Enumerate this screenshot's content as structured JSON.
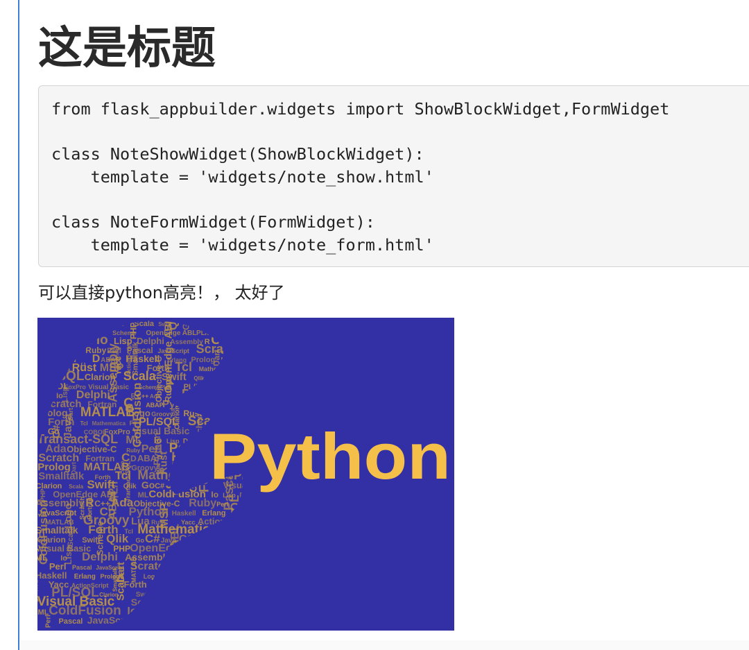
{
  "article": {
    "title": "这是标题",
    "code_lines": [
      "from flask_appbuilder.widgets import ShowBlockWidget,FormWidget",
      "",
      "class NoteShowWidget(ShowBlockWidget):",
      "    template = 'widgets/note_show.html'",
      "",
      "class NoteFormWidget(FormWidget):",
      "    template = 'widgets/note_form.html'"
    ],
    "caption": "可以直接python高亮！， 太好了"
  },
  "image": {
    "logo_text": "Python",
    "background_color": "#3230a4",
    "logo_color": "#f4c04a",
    "word_cloud_color": "#b8924a",
    "word_cloud_words": [
      "F#",
      "PL/SQL",
      "Clarion",
      "Scala",
      "Swift",
      "Qlik",
      "Go",
      "C#",
      "Java",
      "COBOL",
      "FoxPro",
      "Visual Basic",
      "Scheme",
      "PHP",
      "OpenEdge ABL",
      "PL/I",
      "Transact-SQL",
      "ML",
      "ColdFusion",
      "Io",
      "Lisp",
      "Delphi",
      "Assembly",
      "R",
      "C++",
      "Ada",
      "Objective-C",
      "Ruby",
      "Perl",
      "Pascal",
      "JavaScript",
      "Scratch",
      "Fortran",
      "C",
      "D",
      "ABAP",
      "Python",
      "Haskell",
      "Erlang",
      "Prolog",
      "Dart",
      "MATLAB",
      "Logo",
      "Groovy",
      "Lua",
      "Rust",
      "MSP",
      "Yacc",
      "ActionScript",
      "Smalltalk",
      "Forth",
      "Tcl",
      "Mathematica"
    ]
  }
}
